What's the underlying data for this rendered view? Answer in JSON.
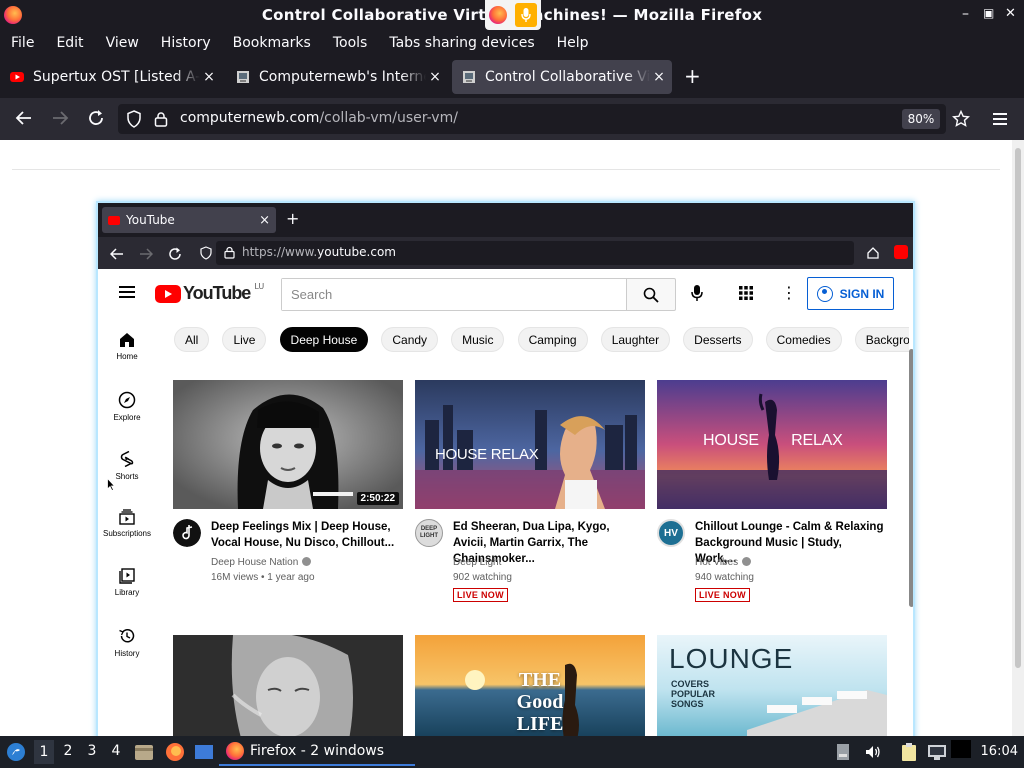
{
  "window": {
    "title": "Control Collaborative Virtual Machines! — Mozilla Firefox",
    "min": "–",
    "max": "▣",
    "close": "✕"
  },
  "menu": [
    "File",
    "Edit",
    "View",
    "History",
    "Bookmarks",
    "Tools",
    "Tabs sharing devices",
    "Help"
  ],
  "tabs": [
    {
      "label": "Supertux OST [Listed A-Z]"
    },
    {
      "label": "Computernewb's Internet"
    },
    {
      "label": "Control Collaborative Virtual Machines"
    }
  ],
  "tab_close": "×",
  "new_tab": "+",
  "url": {
    "domain": "computernewb.com",
    "path": "/collab-vm/user-vm/"
  },
  "zoom": "80%",
  "vm": {
    "tab_label": "YouTube",
    "url_prefix": "https://www.",
    "url_domain": "youtube.com",
    "youtube": {
      "logo": "YouTube",
      "logo_cc": "LU",
      "search_placeholder": "Search",
      "sign_in": "SIGN IN",
      "sidebar": [
        "Home",
        "Explore",
        "Shorts",
        "Subscriptions",
        "Library",
        "History"
      ],
      "chips": [
        "All",
        "Live",
        "Deep House",
        "Candy",
        "Music",
        "Camping",
        "Laughter",
        "Desserts",
        "Comedies",
        "Background music"
      ],
      "selected_chip": "Deep House",
      "videos": [
        {
          "title": "Deep Feelings Mix | Deep House, Vocal House, Nu Disco, Chillout...",
          "channel": "Deep House Nation",
          "meta": "16M views • 1 year ago",
          "duration": "2:50:22",
          "badge": ""
        },
        {
          "title": "Ed Sheeran, Dua Lipa, Kygo, Avicii, Martin Garrix, The Chainsmoker...",
          "channel": "Deep Light",
          "meta": "902 watching",
          "duration": "",
          "badge": "LIVE NOW",
          "thumb_text": "HOUSE RELAX",
          "av_text": "DEEP LIGHT"
        },
        {
          "title": "Chillout Lounge - Calm & Relaxing Background Music | Study, Work,...",
          "channel": "Hot Vibes",
          "meta": "940 watching",
          "duration": "",
          "badge": "LIVE NOW",
          "thumb_text": "HOUSE RELAX",
          "av_text": "HV"
        }
      ],
      "row2": [
        {
          "thumb_text": ""
        },
        {
          "thumb_text": "THE Good LIFE"
        },
        {
          "thumb_text": "LOUNGE",
          "thumb_sub": "COVERS POPULAR SONGS"
        }
      ]
    }
  },
  "taskbar": {
    "workspaces": [
      "1",
      "2",
      "3",
      "4"
    ],
    "firefox_label": "Firefox - 2 windows",
    "clock": "16:04"
  }
}
